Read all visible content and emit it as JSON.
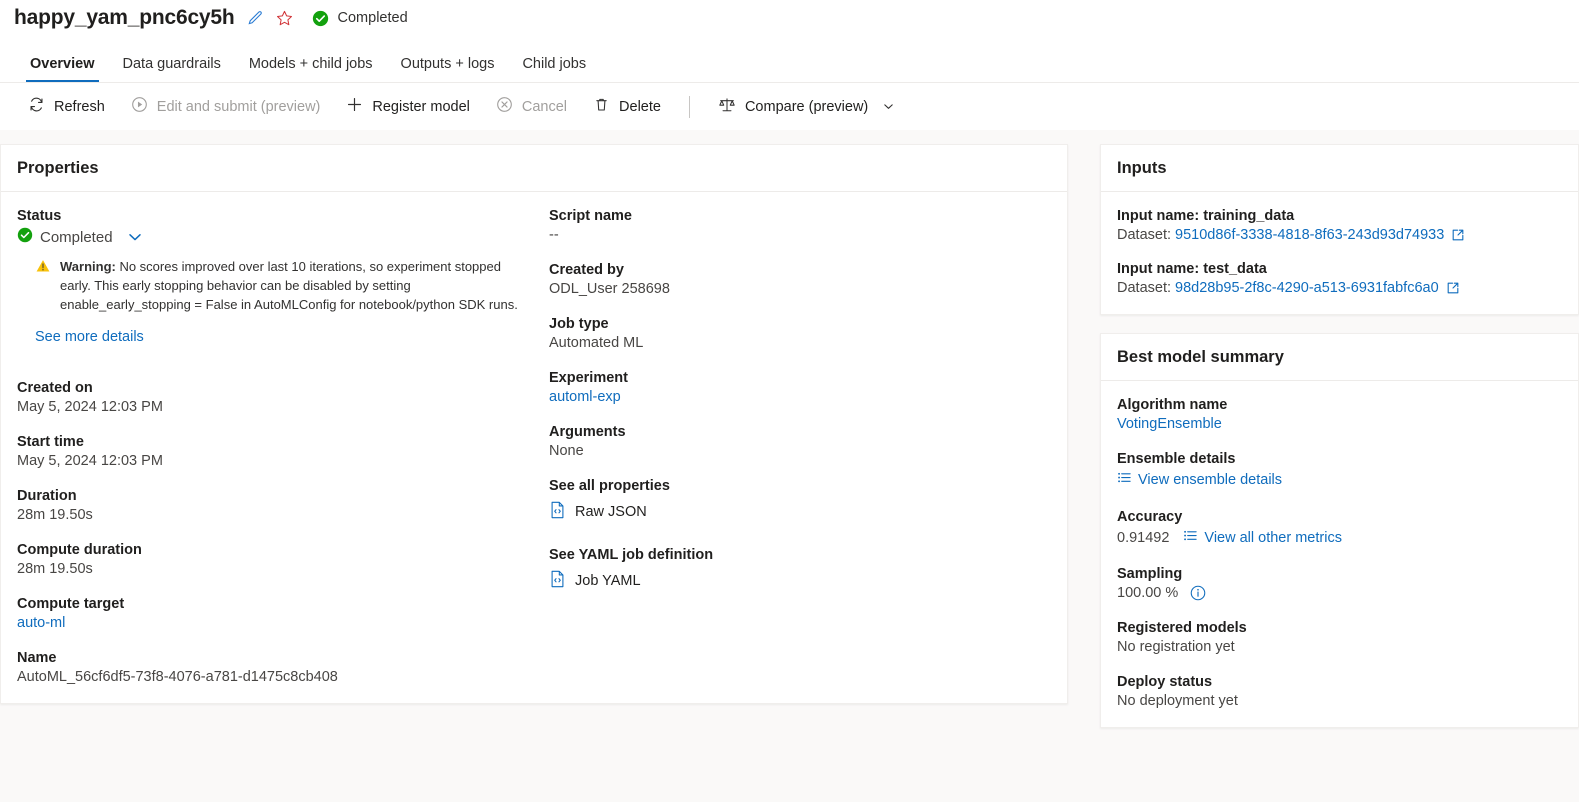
{
  "header": {
    "job_title": "happy_yam_pnc6cy5h",
    "edit_icon": "pencil-icon",
    "favorite_icon": "star-icon",
    "status_icon": "success-check-icon",
    "status_text": "Completed"
  },
  "tabs": [
    {
      "label": "Overview",
      "active": true
    },
    {
      "label": "Data guardrails",
      "active": false
    },
    {
      "label": "Models + child jobs",
      "active": false
    },
    {
      "label": "Outputs + logs",
      "active": false
    },
    {
      "label": "Child jobs",
      "active": false
    }
  ],
  "toolbar": {
    "refresh_label": "Refresh",
    "edit_submit_label": "Edit and submit (preview)",
    "register_model_label": "Register model",
    "cancel_label": "Cancel",
    "delete_label": "Delete",
    "compare_label": "Compare (preview)"
  },
  "properties": {
    "title": "Properties",
    "status_label": "Status",
    "status_value": "Completed",
    "warning_prefix": "Warning:",
    "warning_text": " No scores improved over last 10 iterations, so experiment stopped early. This early stopping behavior can be disabled by setting enable_early_stopping = False in AutoMLConfig for notebook/python SDK runs.",
    "see_more_details": "See more details",
    "created_on_label": "Created on",
    "created_on_value": "May 5, 2024 12:03 PM",
    "start_time_label": "Start time",
    "start_time_value": "May 5, 2024 12:03 PM",
    "duration_label": "Duration",
    "duration_value": "28m 19.50s",
    "compute_duration_label": "Compute duration",
    "compute_duration_value": "28m 19.50s",
    "compute_target_label": "Compute target",
    "compute_target_value": "auto-ml",
    "name_label": "Name",
    "name_value": "AutoML_56cf6df5-73f8-4076-a781-d1475c8cb408",
    "script_name_label": "Script name",
    "script_name_value": "--",
    "created_by_label": "Created by",
    "created_by_value": "ODL_User 258698",
    "job_type_label": "Job type",
    "job_type_value": "Automated ML",
    "experiment_label": "Experiment",
    "experiment_value": "automl-exp",
    "arguments_label": "Arguments",
    "arguments_value": "None",
    "see_all_properties_label": "See all properties",
    "raw_json_label": "Raw JSON",
    "see_yaml_label": "See YAML job definition",
    "job_yaml_label": "Job YAML"
  },
  "inputs": {
    "title": "Inputs",
    "items": [
      {
        "name_label": "Input name: training_data",
        "dataset_prefix": "Dataset:",
        "dataset_id": "9510d86f-3338-4818-8f63-243d93d74933"
      },
      {
        "name_label": "Input name: test_data",
        "dataset_prefix": "Dataset:",
        "dataset_id": "98d28b95-2f8c-4290-a513-6931fabfc6a0"
      }
    ]
  },
  "best_model": {
    "title": "Best model summary",
    "algorithm_label": "Algorithm name",
    "algorithm_value": "VotingEnsemble",
    "ensemble_label": "Ensemble details",
    "ensemble_link": "View ensemble details",
    "accuracy_label": "Accuracy",
    "accuracy_value": "0.91492",
    "accuracy_link": "View all other metrics",
    "sampling_label": "Sampling",
    "sampling_value": "100.00 %",
    "registered_models_label": "Registered models",
    "registered_models_value": "No registration yet",
    "deploy_status_label": "Deploy status",
    "deploy_status_value": "No deployment yet"
  },
  "colors": {
    "accent_blue": "#0f6cbd",
    "success_green": "#107c10",
    "warning_amber": "#f8c20a",
    "page_bg": "#faf9f8",
    "card_bg": "#ffffff"
  }
}
